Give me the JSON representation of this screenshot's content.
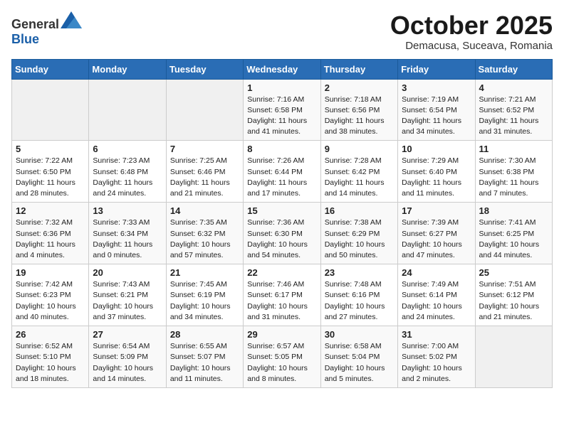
{
  "header": {
    "logo_general": "General",
    "logo_blue": "Blue",
    "month_title": "October 2025",
    "subtitle": "Demacusa, Suceava, Romania"
  },
  "weekdays": [
    "Sunday",
    "Monday",
    "Tuesday",
    "Wednesday",
    "Thursday",
    "Friday",
    "Saturday"
  ],
  "weeks": [
    [
      {
        "day": "",
        "sunrise": "",
        "sunset": "",
        "daylight": ""
      },
      {
        "day": "",
        "sunrise": "",
        "sunset": "",
        "daylight": ""
      },
      {
        "day": "",
        "sunrise": "",
        "sunset": "",
        "daylight": ""
      },
      {
        "day": "1",
        "sunrise": "Sunrise: 7:16 AM",
        "sunset": "Sunset: 6:58 PM",
        "daylight": "Daylight: 11 hours and 41 minutes."
      },
      {
        "day": "2",
        "sunrise": "Sunrise: 7:18 AM",
        "sunset": "Sunset: 6:56 PM",
        "daylight": "Daylight: 11 hours and 38 minutes."
      },
      {
        "day": "3",
        "sunrise": "Sunrise: 7:19 AM",
        "sunset": "Sunset: 6:54 PM",
        "daylight": "Daylight: 11 hours and 34 minutes."
      },
      {
        "day": "4",
        "sunrise": "Sunrise: 7:21 AM",
        "sunset": "Sunset: 6:52 PM",
        "daylight": "Daylight: 11 hours and 31 minutes."
      }
    ],
    [
      {
        "day": "5",
        "sunrise": "Sunrise: 7:22 AM",
        "sunset": "Sunset: 6:50 PM",
        "daylight": "Daylight: 11 hours and 28 minutes."
      },
      {
        "day": "6",
        "sunrise": "Sunrise: 7:23 AM",
        "sunset": "Sunset: 6:48 PM",
        "daylight": "Daylight: 11 hours and 24 minutes."
      },
      {
        "day": "7",
        "sunrise": "Sunrise: 7:25 AM",
        "sunset": "Sunset: 6:46 PM",
        "daylight": "Daylight: 11 hours and 21 minutes."
      },
      {
        "day": "8",
        "sunrise": "Sunrise: 7:26 AM",
        "sunset": "Sunset: 6:44 PM",
        "daylight": "Daylight: 11 hours and 17 minutes."
      },
      {
        "day": "9",
        "sunrise": "Sunrise: 7:28 AM",
        "sunset": "Sunset: 6:42 PM",
        "daylight": "Daylight: 11 hours and 14 minutes."
      },
      {
        "day": "10",
        "sunrise": "Sunrise: 7:29 AM",
        "sunset": "Sunset: 6:40 PM",
        "daylight": "Daylight: 11 hours and 11 minutes."
      },
      {
        "day": "11",
        "sunrise": "Sunrise: 7:30 AM",
        "sunset": "Sunset: 6:38 PM",
        "daylight": "Daylight: 11 hours and 7 minutes."
      }
    ],
    [
      {
        "day": "12",
        "sunrise": "Sunrise: 7:32 AM",
        "sunset": "Sunset: 6:36 PM",
        "daylight": "Daylight: 11 hours and 4 minutes."
      },
      {
        "day": "13",
        "sunrise": "Sunrise: 7:33 AM",
        "sunset": "Sunset: 6:34 PM",
        "daylight": "Daylight: 11 hours and 0 minutes."
      },
      {
        "day": "14",
        "sunrise": "Sunrise: 7:35 AM",
        "sunset": "Sunset: 6:32 PM",
        "daylight": "Daylight: 10 hours and 57 minutes."
      },
      {
        "day": "15",
        "sunrise": "Sunrise: 7:36 AM",
        "sunset": "Sunset: 6:30 PM",
        "daylight": "Daylight: 10 hours and 54 minutes."
      },
      {
        "day": "16",
        "sunrise": "Sunrise: 7:38 AM",
        "sunset": "Sunset: 6:29 PM",
        "daylight": "Daylight: 10 hours and 50 minutes."
      },
      {
        "day": "17",
        "sunrise": "Sunrise: 7:39 AM",
        "sunset": "Sunset: 6:27 PM",
        "daylight": "Daylight: 10 hours and 47 minutes."
      },
      {
        "day": "18",
        "sunrise": "Sunrise: 7:41 AM",
        "sunset": "Sunset: 6:25 PM",
        "daylight": "Daylight: 10 hours and 44 minutes."
      }
    ],
    [
      {
        "day": "19",
        "sunrise": "Sunrise: 7:42 AM",
        "sunset": "Sunset: 6:23 PM",
        "daylight": "Daylight: 10 hours and 40 minutes."
      },
      {
        "day": "20",
        "sunrise": "Sunrise: 7:43 AM",
        "sunset": "Sunset: 6:21 PM",
        "daylight": "Daylight: 10 hours and 37 minutes."
      },
      {
        "day": "21",
        "sunrise": "Sunrise: 7:45 AM",
        "sunset": "Sunset: 6:19 PM",
        "daylight": "Daylight: 10 hours and 34 minutes."
      },
      {
        "day": "22",
        "sunrise": "Sunrise: 7:46 AM",
        "sunset": "Sunset: 6:17 PM",
        "daylight": "Daylight: 10 hours and 31 minutes."
      },
      {
        "day": "23",
        "sunrise": "Sunrise: 7:48 AM",
        "sunset": "Sunset: 6:16 PM",
        "daylight": "Daylight: 10 hours and 27 minutes."
      },
      {
        "day": "24",
        "sunrise": "Sunrise: 7:49 AM",
        "sunset": "Sunset: 6:14 PM",
        "daylight": "Daylight: 10 hours and 24 minutes."
      },
      {
        "day": "25",
        "sunrise": "Sunrise: 7:51 AM",
        "sunset": "Sunset: 6:12 PM",
        "daylight": "Daylight: 10 hours and 21 minutes."
      }
    ],
    [
      {
        "day": "26",
        "sunrise": "Sunrise: 6:52 AM",
        "sunset": "Sunset: 5:10 PM",
        "daylight": "Daylight: 10 hours and 18 minutes."
      },
      {
        "day": "27",
        "sunrise": "Sunrise: 6:54 AM",
        "sunset": "Sunset: 5:09 PM",
        "daylight": "Daylight: 10 hours and 14 minutes."
      },
      {
        "day": "28",
        "sunrise": "Sunrise: 6:55 AM",
        "sunset": "Sunset: 5:07 PM",
        "daylight": "Daylight: 10 hours and 11 minutes."
      },
      {
        "day": "29",
        "sunrise": "Sunrise: 6:57 AM",
        "sunset": "Sunset: 5:05 PM",
        "daylight": "Daylight: 10 hours and 8 minutes."
      },
      {
        "day": "30",
        "sunrise": "Sunrise: 6:58 AM",
        "sunset": "Sunset: 5:04 PM",
        "daylight": "Daylight: 10 hours and 5 minutes."
      },
      {
        "day": "31",
        "sunrise": "Sunrise: 7:00 AM",
        "sunset": "Sunset: 5:02 PM",
        "daylight": "Daylight: 10 hours and 2 minutes."
      },
      {
        "day": "",
        "sunrise": "",
        "sunset": "",
        "daylight": ""
      }
    ]
  ]
}
